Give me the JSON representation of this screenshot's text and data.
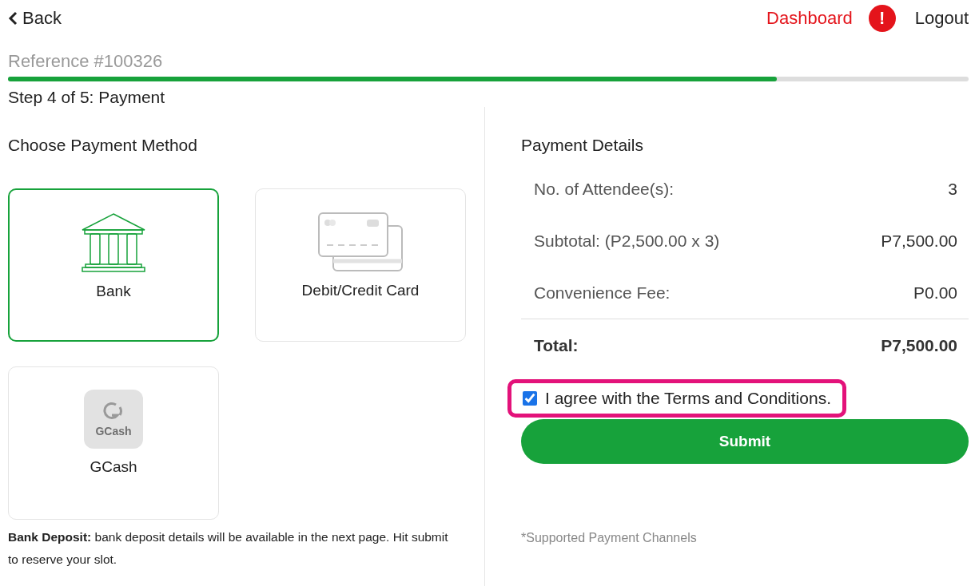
{
  "nav": {
    "back": "Back",
    "dashboard": "Dashboard",
    "alert": "!",
    "logout": "Logout"
  },
  "reference": "Reference #100326",
  "progress": {
    "level": 0.8,
    "step": "Step 4 of 5: Payment"
  },
  "methods_title": "Choose Payment Method",
  "methods": [
    {
      "kind": "bank",
      "label": "Bank",
      "selected": true
    },
    {
      "kind": "card",
      "label": "Debit/Credit Card",
      "selected": false
    },
    {
      "kind": "gcash",
      "label": "GCash",
      "logo_text": "GCash",
      "selected": false
    }
  ],
  "method_note": "**Bank Deposit:** bank deposit details will be available in the next page. Hit submit to reserve your slot.",
  "details": {
    "title": "Payment Details",
    "rows": [
      {
        "label": "No. of Attendee(s):",
        "value": "3"
      },
      {
        "label": "Subtotal: (P2,500.00 x 3)",
        "value": "P7,500.00"
      },
      {
        "label": "Convenience Fee:",
        "value": "P0.00"
      }
    ],
    "total": {
      "label": "Total:",
      "value": "P7,500.00"
    }
  },
  "terms": {
    "label": "I agree with the Terms and Conditions.",
    "checked": true,
    "highlighted": true
  },
  "submit": "Submit",
  "channels_note": "*Supported Payment Channels"
}
